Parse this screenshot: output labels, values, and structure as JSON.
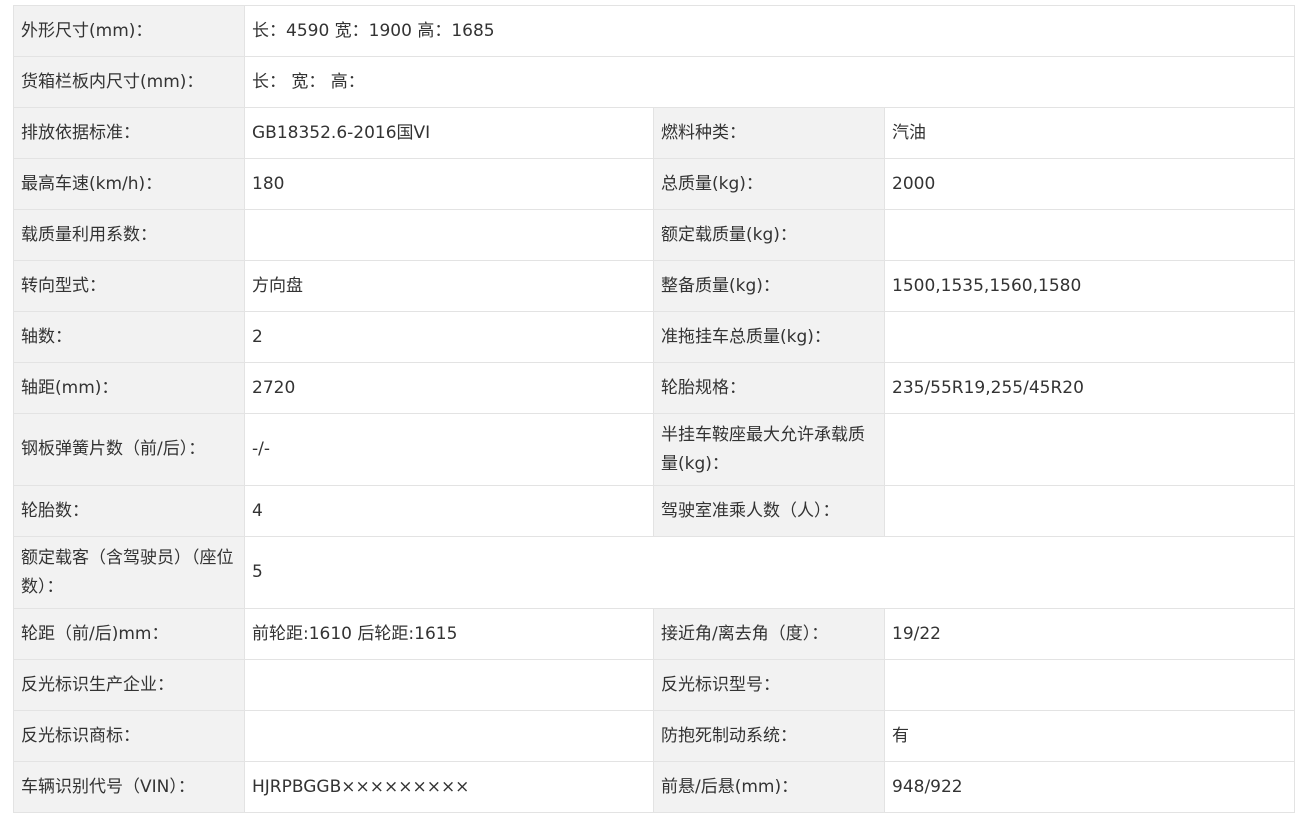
{
  "rows": [
    {
      "label": "外形尺寸(mm)：",
      "value": "长：4590 宽：1900 高：1685"
    },
    {
      "label": "货箱栏板内尺寸(mm)：",
      "value": "长：  宽：  高："
    },
    {
      "label": "排放依据标准：",
      "value": "GB18352.6-2016国VI",
      "label2": "燃料种类：",
      "value2": "汽油"
    },
    {
      "label": "最高车速(km/h)：",
      "value": "180",
      "label2": "总质量(kg)：",
      "value2": "2000"
    },
    {
      "label": "载质量利用系数：",
      "value": "",
      "label2": "额定载质量(kg)：",
      "value2": ""
    },
    {
      "label": "转向型式：",
      "value": "方向盘",
      "label2": "整备质量(kg)：",
      "value2": "1500,1535,1560,1580"
    },
    {
      "label": "轴数：",
      "value": "2",
      "label2": "准拖挂车总质量(kg)：",
      "value2": ""
    },
    {
      "label": "轴距(mm)：",
      "value": "2720",
      "label2": "轮胎规格：",
      "value2": "235/55R19,255/45R20"
    },
    {
      "label": "钢板弹簧片数（前/后）：",
      "value": "-/-",
      "label2": "半挂车鞍座最大允许承载质量(kg)：",
      "value2": ""
    },
    {
      "label": "轮胎数：",
      "value": "4",
      "label2": "驾驶室准乘人数（人）：",
      "value2": ""
    },
    {
      "label": "额定载客（含驾驶员）（座位数）：",
      "value": "5"
    },
    {
      "label": "轮距（前/后)mm：",
      "value": "前轮距:1610 后轮距:1615",
      "label2": "接近角/离去角（度）：",
      "value2": "19/22"
    },
    {
      "label": "反光标识生产企业：",
      "value": "",
      "label2": "反光标识型号：",
      "value2": ""
    },
    {
      "label": "反光标识商标：",
      "value": "",
      "label2": "防抱死制动系统：",
      "value2": "有"
    },
    {
      "label": "车辆识别代号（VIN）：",
      "value": "HJRPBGGB×××××××××",
      "label2": "前悬/后悬(mm)：",
      "value2": "948/922"
    }
  ]
}
